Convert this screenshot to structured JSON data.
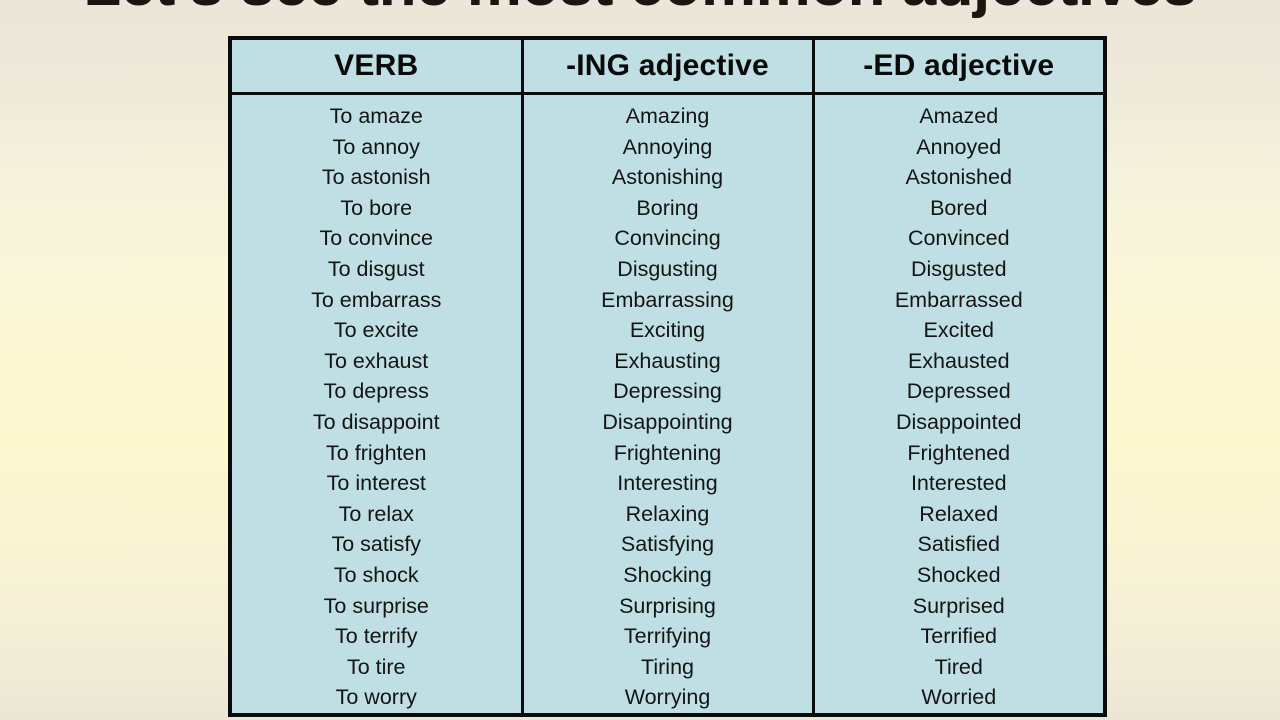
{
  "slide": {
    "title": "Let's see the most common adjectives",
    "background_top_color": "#ece5d9",
    "background_mid_color": "#fcf8d0",
    "title_color": "#1a1510"
  },
  "table": {
    "cell_background_color": "#bfdfe4",
    "border_color": "#0b0b0b",
    "columns": [
      "VERB",
      "-ING adjective",
      "-ED adjective"
    ],
    "rows": [
      [
        "To amaze",
        "Amazing",
        "Amazed"
      ],
      [
        "To annoy",
        "Annoying",
        "Annoyed"
      ],
      [
        "To astonish",
        "Astonishing",
        "Astonished"
      ],
      [
        "To bore",
        "Boring",
        "Bored"
      ],
      [
        "To convince",
        "Convincing",
        "Convinced"
      ],
      [
        "To disgust",
        "Disgusting",
        "Disgusted"
      ],
      [
        "To embarrass",
        "Embarrassing",
        "Embarrassed"
      ],
      [
        "To excite",
        "Exciting",
        "Excited"
      ],
      [
        "To exhaust",
        "Exhausting",
        "Exhausted"
      ],
      [
        "To depress",
        "Depressing",
        "Depressed"
      ],
      [
        "To disappoint",
        "Disappointing",
        "Disappointed"
      ],
      [
        "To frighten",
        "Frightening",
        "Frightened"
      ],
      [
        "To interest",
        "Interesting",
        "Interested"
      ],
      [
        "To relax",
        "Relaxing",
        "Relaxed"
      ],
      [
        "To satisfy",
        "Satisfying",
        "Satisfied"
      ],
      [
        "To shock",
        "Shocking",
        "Shocked"
      ],
      [
        "To surprise",
        "Surprising",
        "Surprised"
      ],
      [
        "To terrify",
        "Terrifying",
        "Terrified"
      ],
      [
        "To tire",
        "Tiring",
        "Tired"
      ],
      [
        "To worry",
        "Worrying",
        "Worried"
      ]
    ]
  }
}
